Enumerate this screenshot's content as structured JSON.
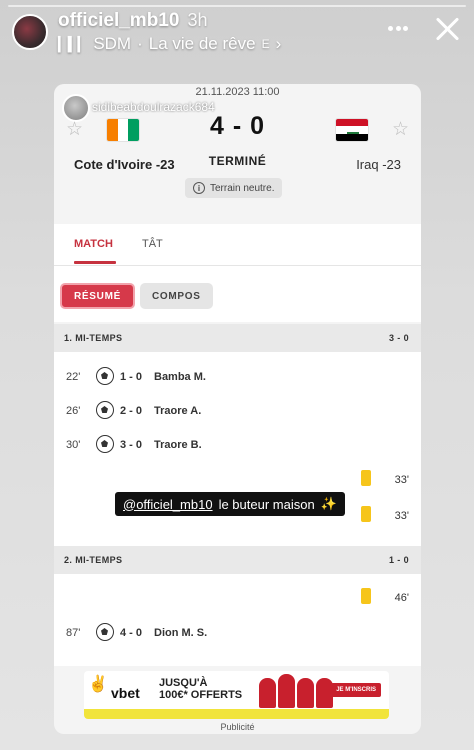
{
  "story": {
    "username": "officiel_mb10",
    "time": "3h",
    "music_artist": "SDM",
    "music_title": "La vie de rêve",
    "music_extra": "E"
  },
  "screenshot": {
    "date": "21.11.2023 11:00",
    "mention": "sidibeabdoulrazack684",
    "home_team": "Cote d'Ivoire -23",
    "away_team": "Iraq -23",
    "score": "4 - 0",
    "status": "TERMINÉ",
    "venue": "Terrain neutre.",
    "tabs": [
      "MATCH",
      "TÂT"
    ],
    "pills": [
      "RÉSUMÉ",
      "COMPOS"
    ],
    "first_half": {
      "title": "1. MI-TEMPS",
      "score": "3 - 0",
      "goals": [
        {
          "minute": "22'",
          "score": "1 - 0",
          "player": "Bamba M."
        },
        {
          "minute": "26'",
          "score": "2 - 0",
          "player": "Traore A."
        },
        {
          "minute": "30'",
          "score": "3 - 0",
          "player": "Traore B."
        }
      ],
      "cards": [
        {
          "minute": "33'"
        },
        {
          "minute": "33'"
        }
      ]
    },
    "second_half": {
      "title": "2. MI-TEMPS",
      "score": "1 - 0",
      "cards": [
        {
          "minute": "46'"
        }
      ],
      "goals": [
        {
          "minute": "87'",
          "score": "4 - 0",
          "player": "Dion M. S."
        }
      ]
    },
    "overlay": {
      "handle": "@officiel_mb10",
      "text": "le buteur maison"
    },
    "ad": {
      "brand": "vbet",
      "line1": "JUSQU'À",
      "line2": "100€* OFFERTS",
      "cta": "JE M'INSCRIS",
      "label": "Publicité"
    }
  },
  "colors": {
    "accent": "#c6323f",
    "yellow_card": "#f6c51b",
    "civ_orange": "#f77f00",
    "civ_green": "#009e60",
    "iraq_red": "#ce1126",
    "iraq_black": "#000000"
  }
}
